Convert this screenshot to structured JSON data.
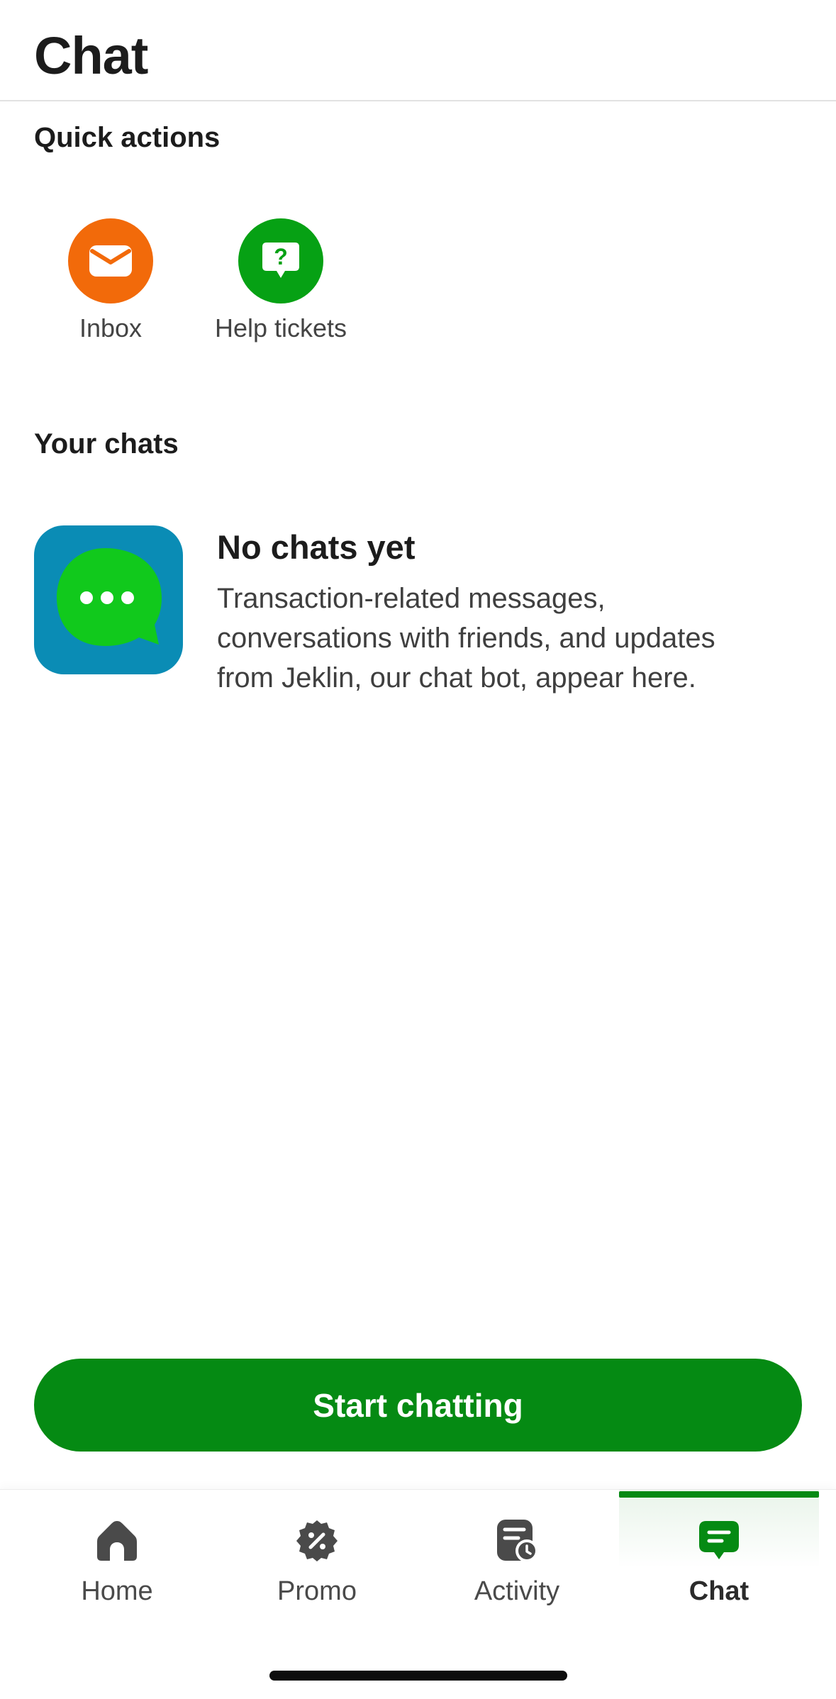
{
  "header": {
    "title": "Chat"
  },
  "quick_actions": {
    "label": "Quick actions",
    "items": [
      {
        "label": "Inbox",
        "icon": "envelope-icon",
        "color": "#f26a0a"
      },
      {
        "label": "Help tickets",
        "icon": "question-bubble-icon",
        "color": "#06a114"
      }
    ]
  },
  "chats": {
    "label": "Your chats",
    "empty": {
      "title": "No chats yet",
      "description": "Transaction-related messages, conversations with friends, and updates from Jeklin, our chat bot, appear here.",
      "icon": "chat-bubble-icon",
      "tile_color": "#0a8cb5",
      "bubble_color": "#11c91c"
    }
  },
  "cta": {
    "label": "Start chatting",
    "color": "#058a13"
  },
  "bottom_nav": {
    "items": [
      {
        "label": "Home",
        "icon": "home-icon",
        "active": false
      },
      {
        "label": "Promo",
        "icon": "promo-icon",
        "active": false
      },
      {
        "label": "Activity",
        "icon": "activity-icon",
        "active": false
      },
      {
        "label": "Chat",
        "icon": "chat-icon",
        "active": true
      }
    ],
    "accent_color": "#058a13"
  }
}
